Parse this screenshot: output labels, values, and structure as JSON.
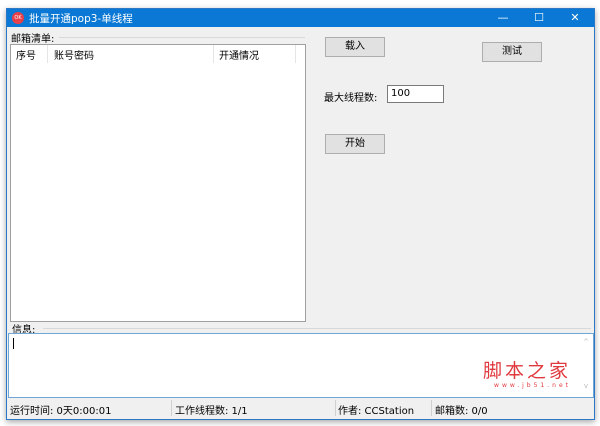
{
  "window": {
    "title": "批量开通pop3-单线程",
    "icon_text": "OK",
    "minimize": "—",
    "maximize": "☐",
    "close": "✕"
  },
  "email_list": {
    "group_label": "邮箱清单:",
    "columns": [
      "序号",
      "账号密码",
      "开通情况"
    ]
  },
  "buttons": {
    "load": "载入",
    "test": "测试",
    "start": "开始"
  },
  "max_threads": {
    "label": "最大线程数:",
    "value": "100"
  },
  "info": {
    "label": "信息:",
    "scroll_up": "^",
    "scroll_down": "v"
  },
  "watermark": {
    "main": "脚本之家",
    "sub": "www.jb51.net"
  },
  "status": {
    "runtime": "运行时间: 0天0:00:01",
    "threads": "工作线程数: 1/1",
    "author": "作者: CCStation",
    "mail_count": "邮箱数: 0/0"
  }
}
